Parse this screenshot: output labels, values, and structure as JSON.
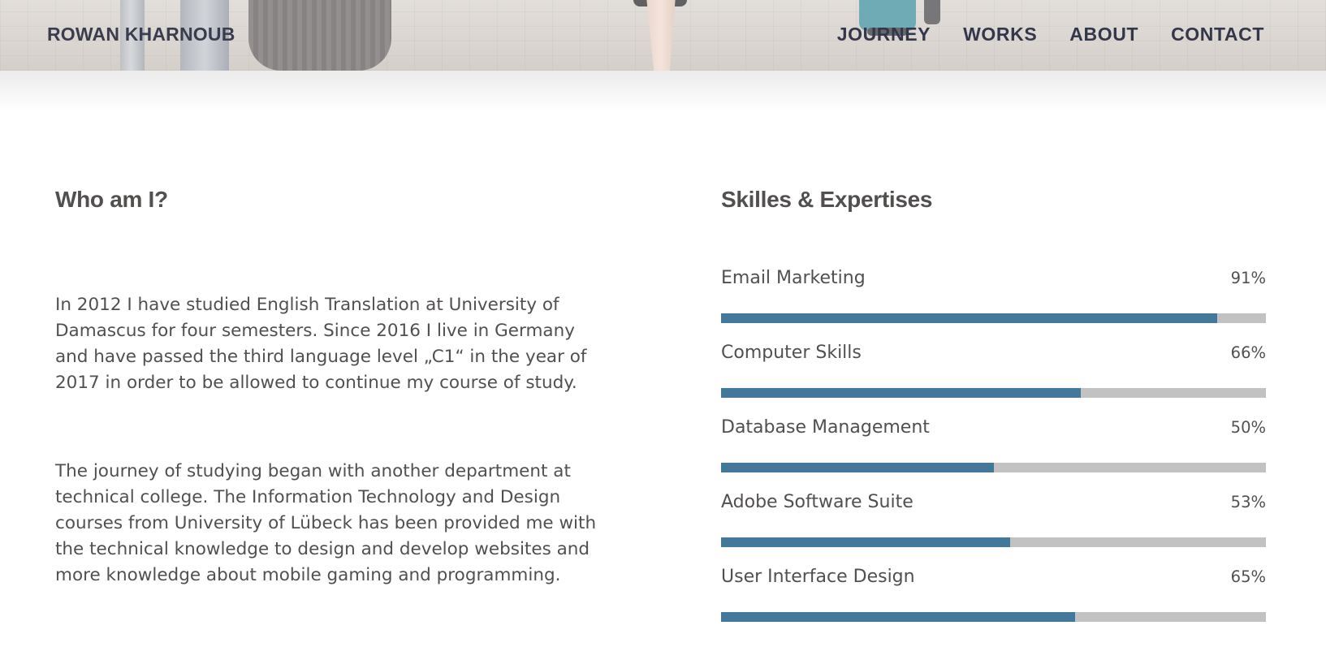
{
  "header": {
    "brand": "ROWAN KHARNOUB",
    "nav": [
      "JOURNEY",
      "WORKS",
      "ABOUT",
      "CONTACT"
    ]
  },
  "about": {
    "title": "Who am I?",
    "paragraphs": [
      "In 2012 I have studied English Translation at University of Damascus for four semesters. Since 2016 I live in Germany and have passed the third language level „C1“ in the year of 2017 in order to be allowed to continue my course of study.",
      "The journey of studying began with another department at technical college. The Information Technology and Design courses from University of Lübeck has been provided me with the technical knowledge to design and develop websites and more knowledge about mobile gaming and programming."
    ]
  },
  "skills": {
    "title": "Skilles & Expertises",
    "items": [
      {
        "label": "Email Marketing",
        "percent_label": "91%",
        "value": 91
      },
      {
        "label": "Computer Skills",
        "percent_label": "66%",
        "value": 66
      },
      {
        "label": "Database Management",
        "percent_label": "50%",
        "value": 50
      },
      {
        "label": "Adobe Software Suite",
        "percent_label": "53%",
        "value": 53
      },
      {
        "label": "User Interface Design",
        "percent_label": "65%",
        "value": 65
      }
    ]
  },
  "colors": {
    "bar_fill": "#44789a",
    "bar_track": "#c2c2c2",
    "text": "#524f4f",
    "nav_text": "#34374a"
  }
}
